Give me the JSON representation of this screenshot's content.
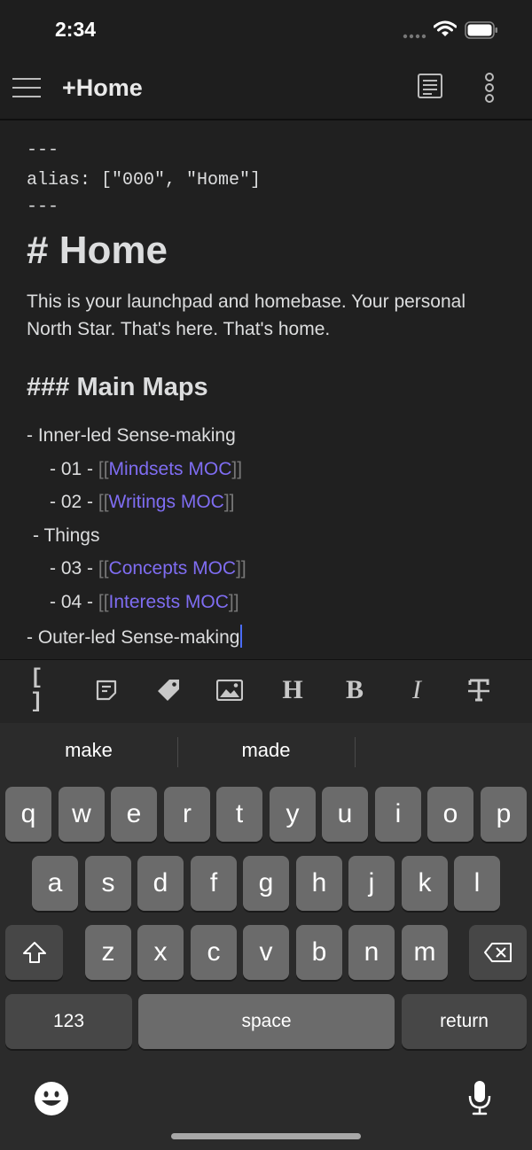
{
  "status_bar": {
    "time": "2:34"
  },
  "header": {
    "title": "+Home"
  },
  "editor": {
    "frontmatter_open": "---",
    "alias_line": "alias: [\"000\", \"Home\"]",
    "frontmatter_close": "---",
    "h1": "# Home",
    "paragraph": "This is your launchpad and homebase. Your personal North Star. That's here. That's home.",
    "h3": "### Main Maps",
    "items": [
      {
        "prefix": "- Inner-led Sense-making"
      },
      {
        "prefix": "- 01 - ",
        "link": "Mindsets MOC"
      },
      {
        "prefix": "- 02 - ",
        "link": "Writings MOC"
      },
      {
        "prefix": "- Things"
      },
      {
        "prefix": "- 03 - ",
        "link": "Concepts MOC"
      },
      {
        "prefix": "- 04 - ",
        "link": "Interests MOC"
      },
      {
        "prefix": "- Outer-led Sense-making"
      }
    ],
    "bracket_open": "[[",
    "bracket_close": "]]"
  },
  "toolbar": {
    "icons": [
      "wikilink-icon",
      "embed-icon",
      "tag-icon",
      "image-icon",
      "heading-icon",
      "bold-icon",
      "italic-icon",
      "strikethrough-icon"
    ],
    "heading_label": "H",
    "bold_label": "B",
    "italic_label": "I",
    "link_label": "[ ]"
  },
  "keyboard": {
    "suggestions": [
      "make",
      "made",
      ""
    ],
    "row1": [
      "q",
      "w",
      "e",
      "r",
      "t",
      "y",
      "u",
      "i",
      "o",
      "p"
    ],
    "row2": [
      "a",
      "s",
      "d",
      "f",
      "g",
      "h",
      "j",
      "k",
      "l"
    ],
    "row3": [
      "z",
      "x",
      "c",
      "v",
      "b",
      "n",
      "m"
    ],
    "numbers_label": "123",
    "space_label": "space",
    "return_label": "return"
  },
  "colors": {
    "link": "#7f6df2",
    "cursor": "#4a6cf7",
    "background": "#202020"
  }
}
